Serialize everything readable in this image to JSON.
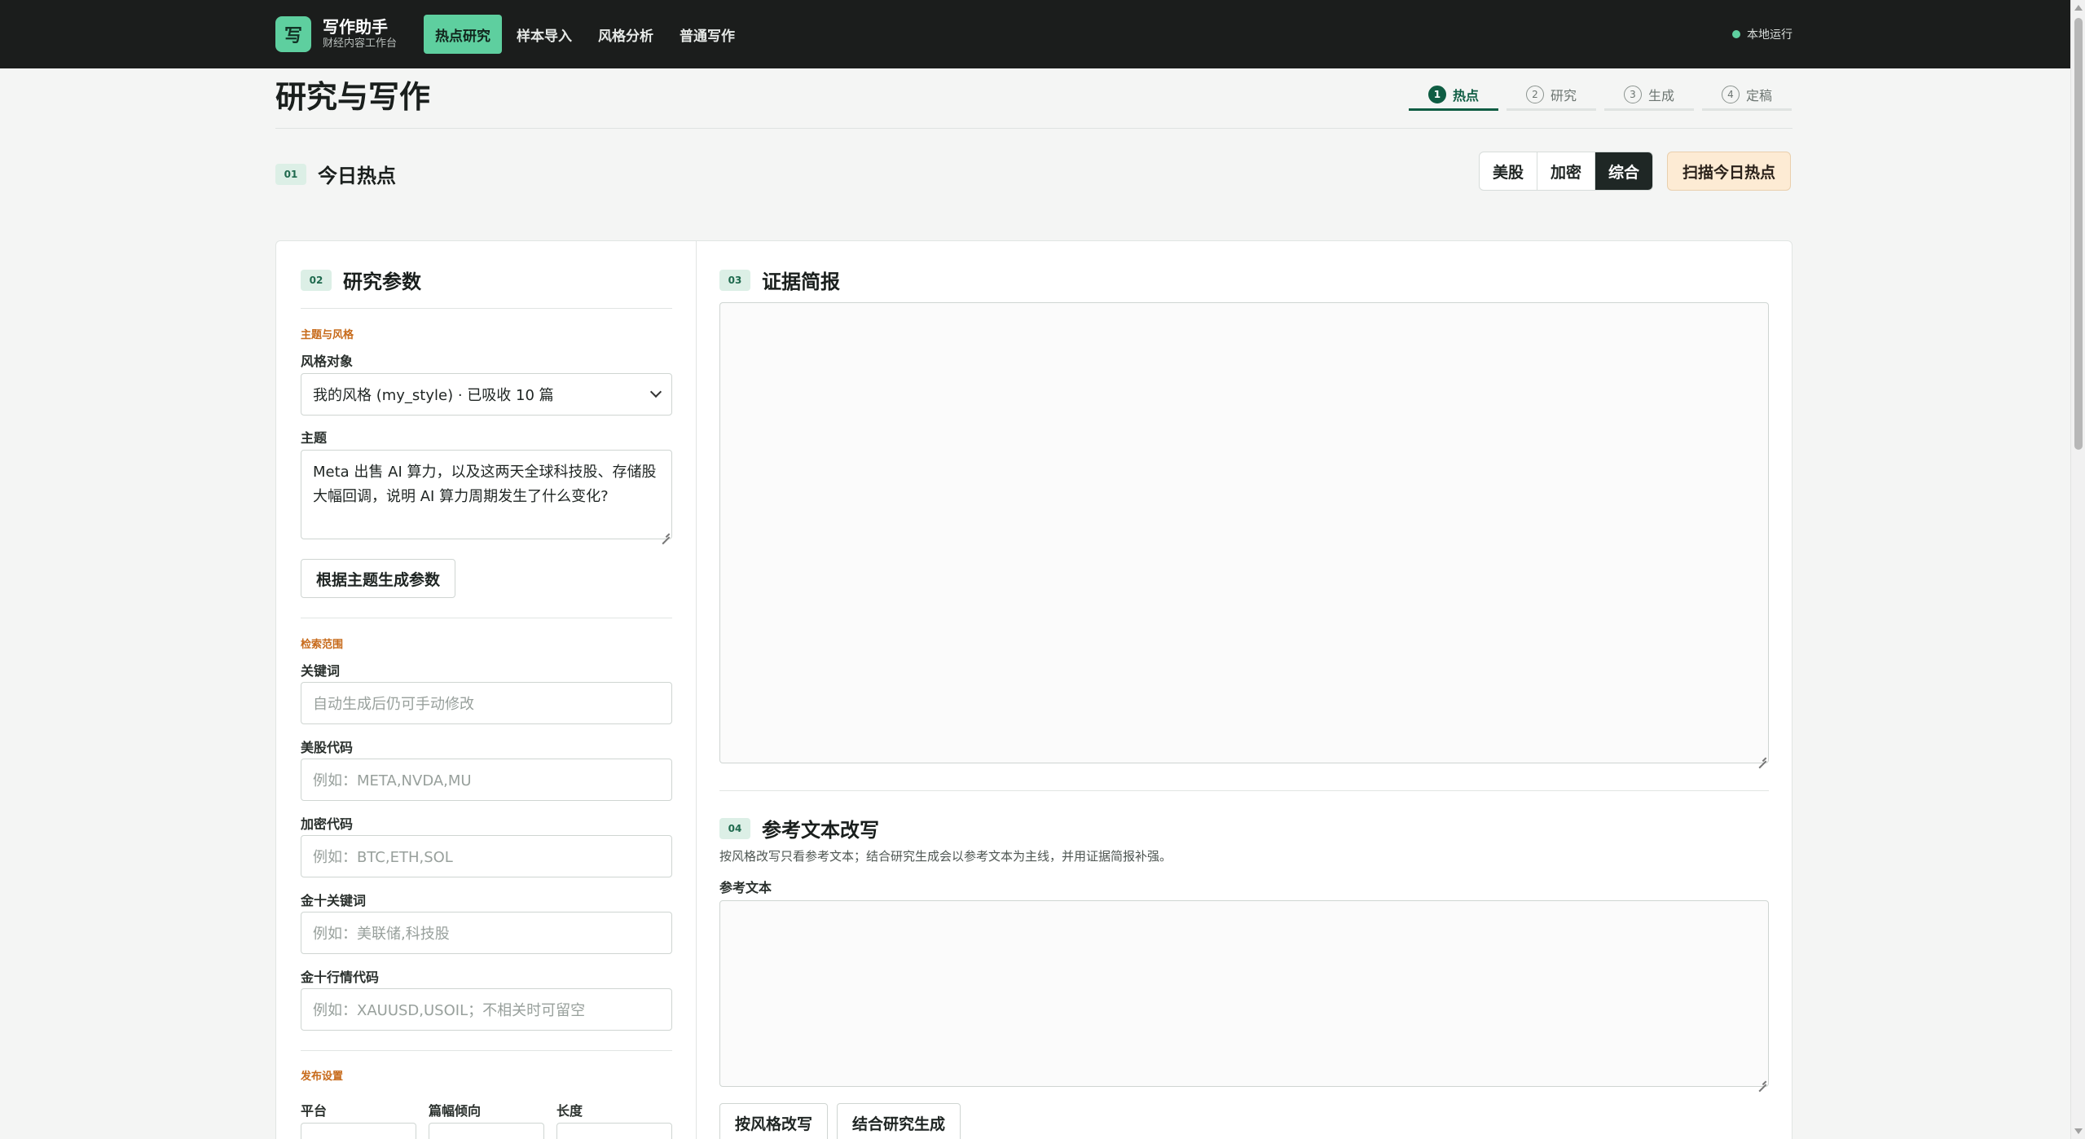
{
  "app": {
    "logo_char": "写",
    "name": "写作助手",
    "subtitle": "财经内容工作台"
  },
  "nav": {
    "items": [
      "热点研究",
      "样本导入",
      "风格分析",
      "普通写作"
    ],
    "active": 0
  },
  "status": {
    "label": "本地运行",
    "color": "#5ecf9f"
  },
  "page": {
    "title": "研究与写作"
  },
  "steps": [
    {
      "num": "1",
      "label": "热点",
      "active": true
    },
    {
      "num": "2",
      "label": "研究",
      "active": false
    },
    {
      "num": "3",
      "label": "生成",
      "active": false
    },
    {
      "num": "4",
      "label": "定稿",
      "active": false
    }
  ],
  "hot": {
    "badge": "01",
    "title": "今日热点",
    "segments": [
      "美股",
      "加密",
      "综合"
    ],
    "active_segment": "综合",
    "scan_label": "扫描今日热点"
  },
  "params": {
    "badge": "02",
    "title": "研究参数",
    "group_theme": "主题与风格",
    "style_label": "风格对象",
    "style_value": "我的风格 (my_style) · 已吸收 10 篇",
    "topic_label": "主题",
    "topic_value": "Meta 出售 AI 算力，以及这两天全球科技股、存储股大幅回调，说明 AI 算力周期发生了什么变化?",
    "gen_button": "根据主题生成参数",
    "group_search": "检索范围",
    "keywords_label": "关键词",
    "keywords_placeholder": "自动生成后仍可手动修改",
    "us_label": "美股代码",
    "us_placeholder": "例如：META,NVDA,MU",
    "crypto_label": "加密代码",
    "crypto_placeholder": "例如：BTC,ETH,SOL",
    "jin10_kw_label": "金十关键词",
    "jin10_kw_placeholder": "例如：美联储,科技股",
    "jin10_code_label": "金十行情代码",
    "jin10_code_placeholder": "例如：XAUUSD,USOIL；不相关时可留空",
    "group_publish": "发布设置",
    "platform_label": "平台",
    "length_pref_label": "篇幅倾向",
    "length_label": "长度"
  },
  "evidence": {
    "badge": "03",
    "title": "证据简报"
  },
  "rewrite": {
    "badge": "04",
    "title": "参考文本改写",
    "hint": "按风格改写只看参考文本；结合研究生成会以参考文本为主线，并用证据简报补强。",
    "ref_label": "参考文本",
    "btn_style": "按风格改写",
    "btn_combine": "结合研究生成"
  },
  "colors": {
    "accent": "#5ecf9f",
    "dark": "#1b1d1c",
    "step_active": "#0f5d43",
    "group_label": "#c76a1a",
    "scan_bg": "#fdebd4"
  },
  "icons": {
    "status": "status-dot-icon",
    "chevron": "chevron-down-icon"
  }
}
